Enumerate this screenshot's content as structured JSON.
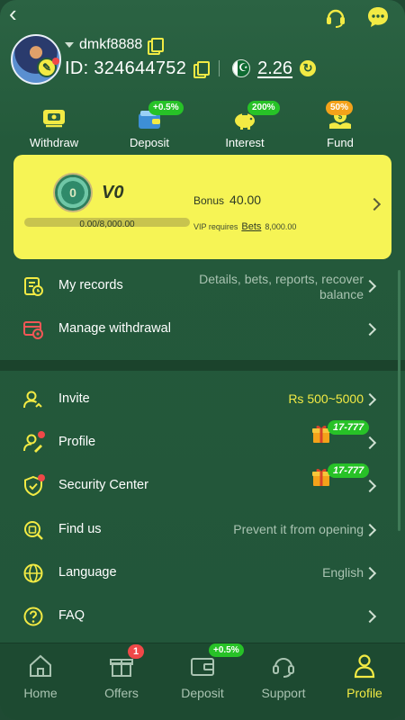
{
  "header": {
    "username": "dmkf8888",
    "user_id": "ID: 324644752",
    "balance": "2.26",
    "icons": [
      "back-icon",
      "headset-support-icon",
      "chat-bubble-icon",
      "copy-icon",
      "pakistan-flag-icon",
      "refresh-icon"
    ]
  },
  "actions": [
    {
      "label": "Withdraw",
      "badge": "",
      "icon": "withdraw-card-icon"
    },
    {
      "label": "Deposit",
      "badge": "+0.5%",
      "icon": "deposit-wallet-icon"
    },
    {
      "label": "Interest",
      "badge": "200%",
      "icon": "piggy-bank-icon"
    },
    {
      "label": "Fund",
      "badge": "50%",
      "icon": "fund-coin-icon"
    }
  ],
  "vip": {
    "level": "V0",
    "progress_text": "0.00/8,000.00",
    "progress_fraction": 0,
    "bonus_label": "Bonus",
    "bonus_value": "40.00",
    "requires_label": "VIP requires",
    "requires_link": "Bets",
    "requires_value": "8,000.00"
  },
  "menu_top": [
    {
      "title": "My records",
      "detail": "Details, bets, reports, recover balance",
      "icon": "records-icon"
    },
    {
      "title": "Manage withdrawal",
      "detail": "",
      "icon": "withdrawal-settings-icon"
    }
  ],
  "menu_bottom": [
    {
      "title": "Invite",
      "detail": "Rs 500~5000",
      "icon": "invite-user-icon"
    },
    {
      "title": "Profile",
      "detail": "",
      "gift": "17-777",
      "icon": "profile-edit-icon"
    },
    {
      "title": "Security Center",
      "detail": "",
      "gift": "17-777",
      "icon": "shield-check-icon"
    },
    {
      "title": "Find us",
      "detail": "Prevent it from opening",
      "icon": "find-us-icon"
    },
    {
      "title": "Language",
      "detail": "English",
      "icon": "globe-icon"
    },
    {
      "title": "FAQ",
      "detail": "",
      "icon": "question-icon"
    }
  ],
  "bottom_nav": [
    {
      "label": "Home",
      "badge": "",
      "icon": "home-icon"
    },
    {
      "label": "Offers",
      "badge": "1",
      "icon": "gift-box-icon"
    },
    {
      "label": "Deposit",
      "badge": "+0.5%",
      "icon": "deposit-wallet-icon"
    },
    {
      "label": "Support",
      "badge": "",
      "icon": "headset-support-icon"
    },
    {
      "label": "Profile",
      "badge": "",
      "icon": "profile-icon",
      "active": true
    }
  ],
  "colors": {
    "background": "#245a3b",
    "accent_yellow": "#f2ea44",
    "vip_card": "#f6f455",
    "badge_green": "#27c227",
    "badge_red": "#f04848"
  }
}
